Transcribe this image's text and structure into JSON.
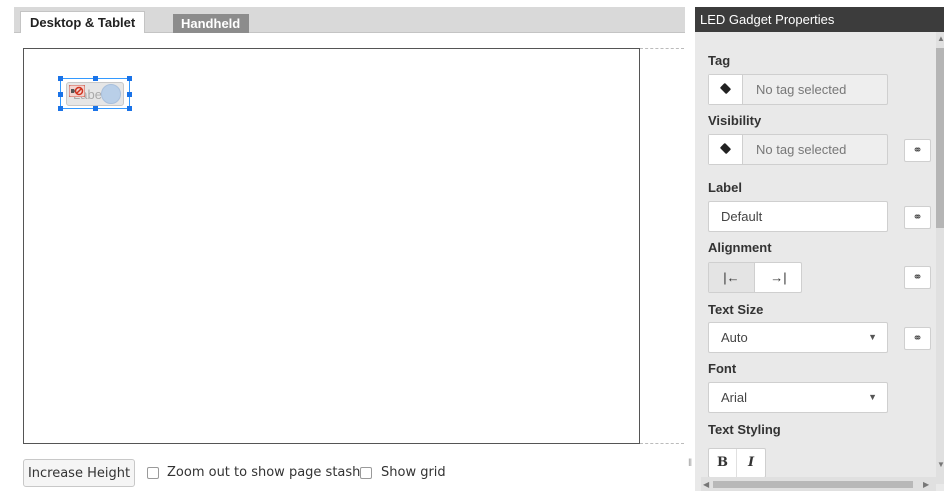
{
  "tabs": {
    "desktop": "Desktop & Tablet",
    "handheld": "Handheld"
  },
  "gadget": {
    "label": "Label"
  },
  "bottom": {
    "increase_height": "Increase Height",
    "zoom_out": "Zoom out to show page stash",
    "show_grid": "Show grid"
  },
  "panel": {
    "title": "LED Gadget Properties",
    "tag": {
      "label": "Tag",
      "value": "No tag selected"
    },
    "visibility": {
      "label": "Visibility",
      "value": "No tag selected"
    },
    "label_field": {
      "label": "Label",
      "value": "Default"
    },
    "alignment": {
      "label": "Alignment",
      "left": "|←",
      "right": "→|",
      "selected": "left"
    },
    "text_size": {
      "label": "Text Size",
      "value": "Auto"
    },
    "font": {
      "label": "Font",
      "value": "Arial"
    },
    "text_styling": {
      "label": "Text Styling",
      "bold": "B",
      "italic": "I"
    }
  },
  "colors": {
    "panel_title_bg": "#3c3c3c",
    "selection_blue": "#1a73e8",
    "tab_inactive": "#8c8c8c"
  }
}
